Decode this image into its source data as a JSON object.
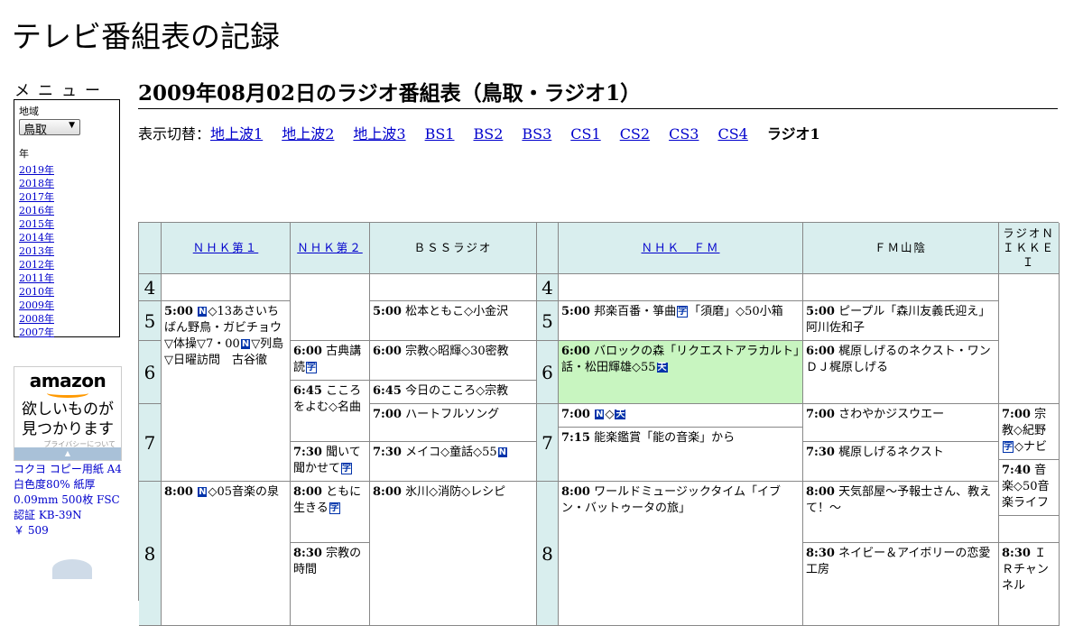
{
  "site_title": "テレビ番組表の記録",
  "menu": {
    "title": "メニュー",
    "region_label": "地域",
    "region_selected": "鳥取",
    "year_label": "年",
    "years": [
      "2019年",
      "2018年",
      "2017年",
      "2016年",
      "2015年",
      "2014年",
      "2013年",
      "2012年",
      "2011年",
      "2010年",
      "2009年",
      "2008年",
      "2007年"
    ]
  },
  "ad": {
    "logo": "amazon",
    "line1": "欲しいものが",
    "line2": "見つかります",
    "privacy": "プライバシーについて",
    "product": "コクヨ コピー用紙 A4 白色度80% 紙厚 0.09mm 500枚 FSC認証 KB-39N",
    "price": "￥ 509"
  },
  "page_heading": "2009年08月02日のラジオ番組表（鳥取・ラジオ1）",
  "switcher": {
    "label": "表示切替：",
    "links": [
      "地上波1",
      "地上波2",
      "地上波3",
      "BS1",
      "BS2",
      "BS3",
      "CS1",
      "CS2",
      "CS3",
      "CS4"
    ],
    "current": "ラジオ1"
  },
  "channels": [
    "ＮＨＫ第１",
    "ＮＨＫ第２",
    "ＢＳＳラジオ",
    "ＮＨＫ　ＦＭ",
    "ＦＭ山陰",
    "ラジオＮＩＫＫＥＩ"
  ],
  "hours": [
    "4",
    "5",
    "6",
    "7",
    "8",
    "4",
    "5",
    "6",
    "7",
    "8"
  ],
  "programs": {
    "nhk1_0500": {
      "time": "5:00",
      "pre": "",
      "post": "◇13あさいちばん野鳥・ガビチョウ▽体操▽7・00",
      "post2": "▽列島▽日曜訪問　古谷徹"
    },
    "nhk1_0800": {
      "time": "8:00",
      "pre": "",
      "post": "◇05音楽の泉"
    },
    "nhk2_0600": {
      "time": "6:00",
      "text": "古典講読"
    },
    "nhk2_0645": {
      "time": "6:45",
      "text": "こころをよむ◇名曲"
    },
    "nhk2_0730": {
      "time": "7:30",
      "text": "聞いて聞かせて"
    },
    "nhk2_0800": {
      "time": "8:00",
      "text": "ともに生きる"
    },
    "nhk2_0830": {
      "time": "8:30",
      "text": "宗教の時間"
    },
    "bss_0500": {
      "time": "5:00",
      "text": "松本ともこ◇小金沢"
    },
    "bss_0600": {
      "time": "6:00",
      "text": "宗教◇昭輝◇30密教"
    },
    "bss_0645": {
      "time": "6:45",
      "text": "今日のこころ◇宗教"
    },
    "bss_0700": {
      "time": "7:00",
      "text": "ハートフルソング"
    },
    "bss_0730": {
      "time": "7:30",
      "text": "メイコ◇童話◇55"
    },
    "bss_0800": {
      "time": "8:00",
      "text": "氷川◇消防◇レシピ"
    },
    "fm_0500": {
      "time": "5:00",
      "text": "邦楽百番・箏曲",
      "text2": "「須磨」◇50小箱"
    },
    "fm_0600": {
      "time": "6:00",
      "text": "バロックの森「リクエストアラカルト」話・松田輝雄◇55"
    },
    "fm_0700": {
      "time": "7:00",
      "text": "◇"
    },
    "fm_0715": {
      "time": "7:15",
      "text": "能楽鑑賞「能の音楽」から"
    },
    "fm_0800": {
      "time": "8:00",
      "text": "ワールドミュージックタイム「イブン・バットゥータの旅」"
    },
    "san_0500": {
      "time": "5:00",
      "text": "ピープル「森川友義氏迎え」阿川佐和子"
    },
    "san_0600": {
      "time": "6:00",
      "text": "梶原しげるのネクスト・ワンＤＪ梶原しげる"
    },
    "san_0700": {
      "time": "7:00",
      "text": "さわやかジスウエー"
    },
    "san_0730": {
      "time": "7:30",
      "text": "梶原しげるネクスト"
    },
    "san_0800": {
      "time": "8:00",
      "text": "天気部屋～予報士さん、教えて！～"
    },
    "san_0830": {
      "time": "8:30",
      "text": "ネイビー＆アイボリーの恋愛工房"
    },
    "nik_0700": {
      "time": "7:00",
      "text": "宗教◇紀野",
      "text2": "◇ナビ"
    },
    "nik_0740": {
      "time": "7:40",
      "text": "音楽◇50音楽ライフ"
    },
    "nik_0830": {
      "time": "8:30",
      "text": "ＩＲチャンネル"
    }
  },
  "icons": {
    "news": "N",
    "stereo": "天",
    "caption": "字"
  },
  "colors": {
    "header_bg": "#d9eeee",
    "highlight_bg": "#c8f5c0",
    "link": "#0000cc"
  }
}
